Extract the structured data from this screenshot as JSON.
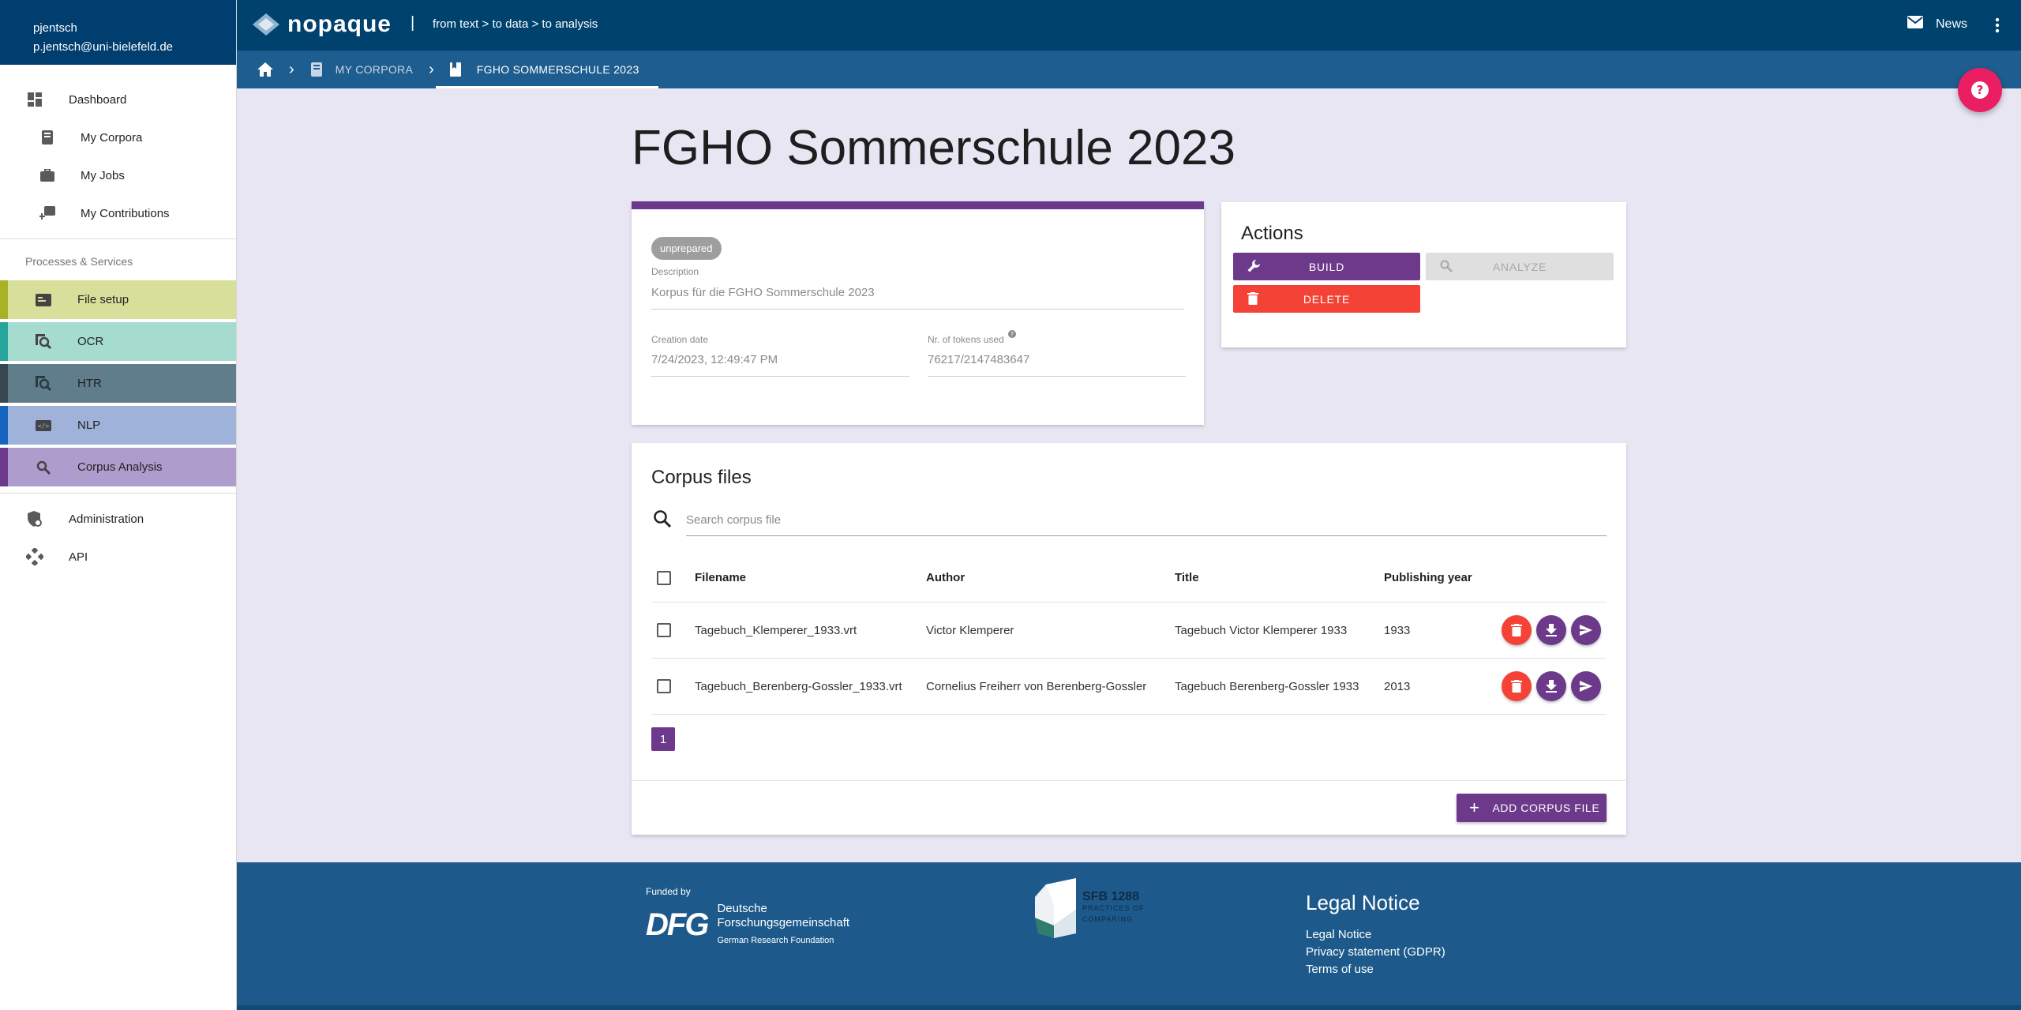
{
  "user": {
    "name": "pjentsch",
    "email": "p.jentsch@uni-bielefeld.de"
  },
  "sidebar": {
    "items": [
      {
        "label": "Dashboard",
        "icon": "dashboard-icon"
      },
      {
        "label": "My Corpora",
        "icon": "corpora-icon"
      },
      {
        "label": "My Jobs",
        "icon": "jobs-icon"
      },
      {
        "label": "My Contributions",
        "icon": "contributions-icon"
      }
    ],
    "services_header": "Processes & Services",
    "services": [
      {
        "label": "File setup",
        "bar": "#a9b224",
        "bg": "#d8df9b"
      },
      {
        "label": "OCR",
        "bar": "#26a69a",
        "bg": "#a6dbd0"
      },
      {
        "label": "HTR",
        "bar": "#37474f",
        "bg": "#607d8b"
      },
      {
        "label": "NLP",
        "bar": "#1565c0",
        "bg": "#9fb2d9"
      },
      {
        "label": "Corpus Analysis",
        "bar": "#6d3a8b",
        "bg": "#ae9ccc"
      }
    ],
    "admin_label": "Administration",
    "api_label": "API"
  },
  "topnav": {
    "logo": "nopaque",
    "separator": "|",
    "tagline": "from text > to data > to analysis",
    "news": "News"
  },
  "breadcrumb": {
    "my_corpora": "My Corpora",
    "current": "FGHO Sommerschule 2023"
  },
  "page": {
    "title": "FGHO Sommerschule 2023"
  },
  "info": {
    "status": "unprepared",
    "description_label": "Description",
    "description": "Korpus für die FGHO Sommerschule 2023",
    "creation_label": "Creation date",
    "creation": "7/24/2023, 12:49:47 PM",
    "tokens_label": "Nr. of tokens used",
    "tokens": "76217/2147483647"
  },
  "actions": {
    "title": "Actions",
    "build": "Build",
    "analyze": "Analyze",
    "delete": "Delete"
  },
  "files": {
    "title": "Corpus files",
    "search_placeholder": "Search corpus file",
    "columns": [
      "Filename",
      "Author",
      "Title",
      "Publishing year"
    ],
    "rows": [
      {
        "filename": "Tagebuch_Klemperer_1933.vrt",
        "author": "Victor Klemperer",
        "title": "Tagebuch Victor Klemperer 1933",
        "year": "1933"
      },
      {
        "filename": "Tagebuch_Berenberg-Gossler_1933.vrt",
        "author": "Cornelius Freiherr von Berenberg-Gossler",
        "title": "Tagebuch Berenberg-Gossler 1933",
        "year": "2013"
      }
    ],
    "page": "1",
    "add_button": "Add corpus file"
  },
  "footer": {
    "funded_by": "Funded by",
    "dfg_mark": "DFG",
    "dfg_line1": "Deutsche",
    "dfg_line2": "Forschungsgemeinschaft",
    "dfg_en": "German Research Foundation",
    "sfb_title": "SFB 1288",
    "sfb_sub1": "PRACTICES OF",
    "sfb_sub2": "COMPARING",
    "legal_title": "Legal Notice",
    "links": [
      "Legal Notice",
      "Privacy statement (GDPR)",
      "Terms of use"
    ]
  },
  "colors": {
    "primary": "#00426e",
    "accent": "#6d3a8b",
    "danger": "#f44336",
    "fab": "#e91e63"
  }
}
